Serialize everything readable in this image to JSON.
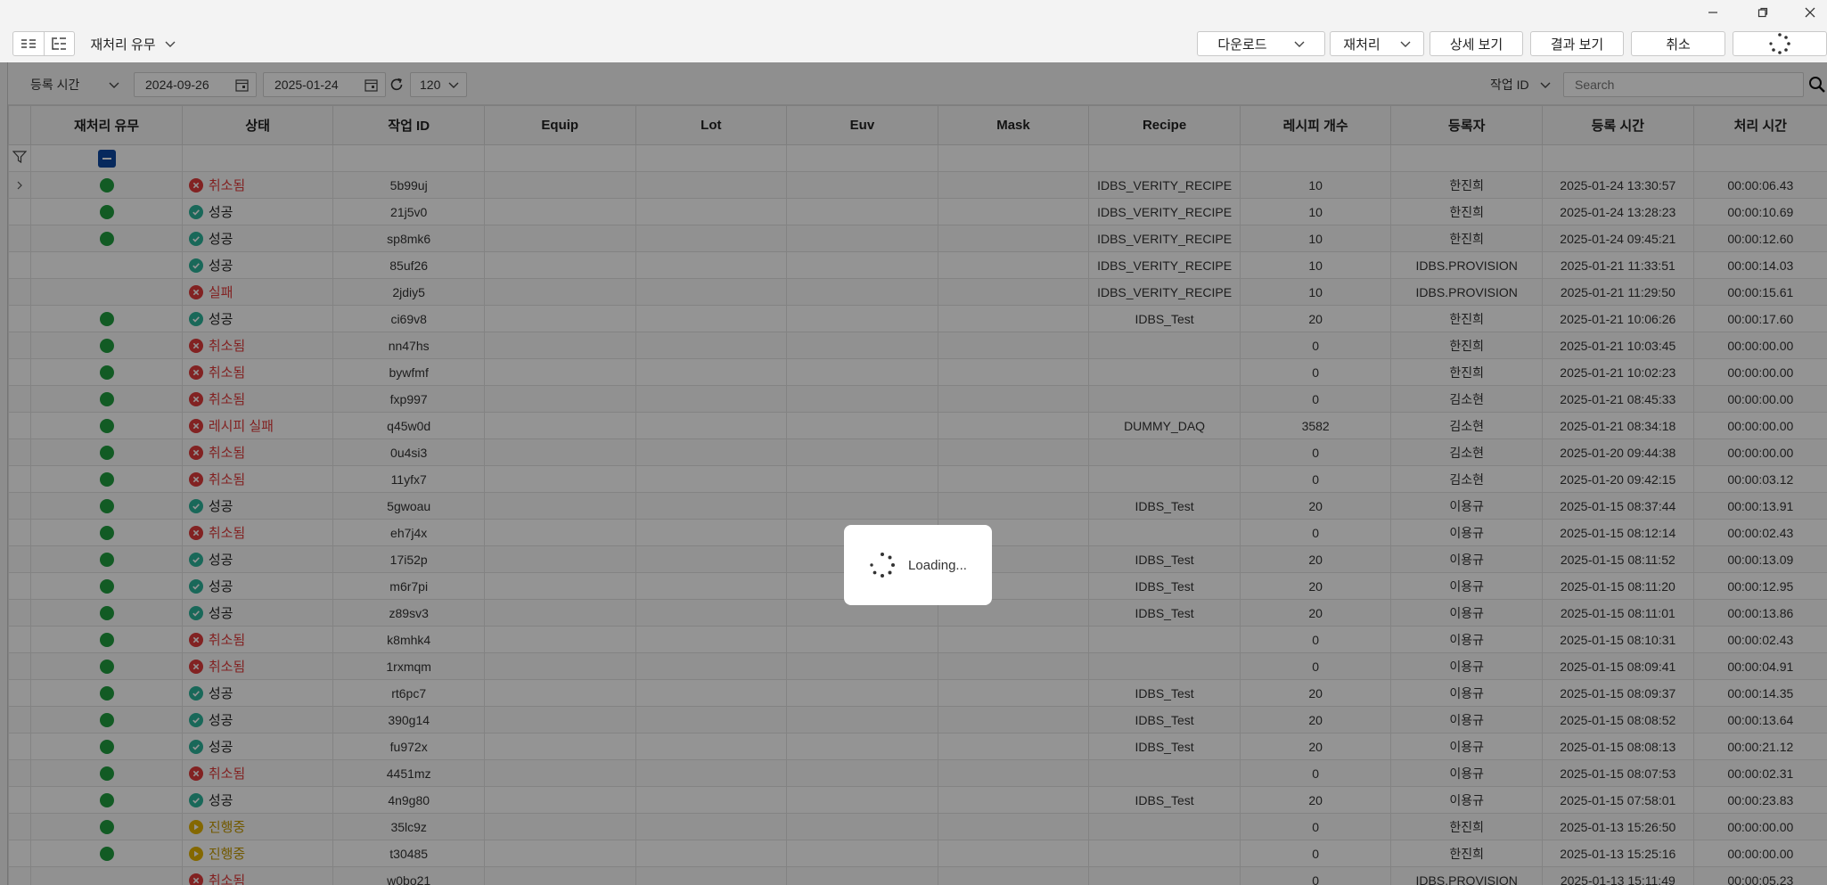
{
  "window": {
    "minimize_icon": "minimize-icon",
    "restore_icon": "restore-icon",
    "close_icon": "close-icon"
  },
  "toolbar": {
    "reprocess_filter_label": "재처리 유무",
    "download_label": "다운로드",
    "reprocess_label": "재처리",
    "detail_label": "상세 보기",
    "result_label": "결과 보기",
    "cancel_label": "취소"
  },
  "filters": {
    "date_field": "등록 시간",
    "start_date": "2024-09-26",
    "end_date": "2025-01-24",
    "page_size": "120",
    "search_field": "작업 ID",
    "search_placeholder": "Search"
  },
  "table": {
    "columns": [
      "재처리 유무",
      "상태",
      "작업 ID",
      "Equip",
      "Lot",
      "Euv",
      "Mask",
      "Recipe",
      "레시피 개수",
      "등록자",
      "등록 시간",
      "처리 시간"
    ],
    "rows": [
      {
        "reprocessed": true,
        "status": "취소됨",
        "kind": "x",
        "id": "5b99uj",
        "recipe": "IDBS_VERITY_RECIPE",
        "count": "10",
        "user": "한진희",
        "registered": "2025-01-24 13:30:57",
        "duration": "00:00:06.43"
      },
      {
        "reprocessed": true,
        "status": "성공",
        "kind": "ok",
        "id": "21j5v0",
        "recipe": "IDBS_VERITY_RECIPE",
        "count": "10",
        "user": "한진희",
        "registered": "2025-01-24 13:28:23",
        "duration": "00:00:10.69"
      },
      {
        "reprocessed": true,
        "status": "성공",
        "kind": "ok",
        "id": "sp8mk6",
        "recipe": "IDBS_VERITY_RECIPE",
        "count": "10",
        "user": "한진희",
        "registered": "2025-01-24 09:45:21",
        "duration": "00:00:12.60"
      },
      {
        "reprocessed": false,
        "status": "성공",
        "kind": "ok",
        "id": "85uf26",
        "recipe": "IDBS_VERITY_RECIPE",
        "count": "10",
        "user": "IDBS.PROVISION",
        "registered": "2025-01-21 11:33:51",
        "duration": "00:00:14.03"
      },
      {
        "reprocessed": false,
        "status": "실패",
        "kind": "x",
        "id": "2jdiy5",
        "recipe": "IDBS_VERITY_RECIPE",
        "count": "10",
        "user": "IDBS.PROVISION",
        "registered": "2025-01-21 11:29:50",
        "duration": "00:00:15.61"
      },
      {
        "reprocessed": true,
        "status": "성공",
        "kind": "ok",
        "id": "ci69v8",
        "recipe": "IDBS_Test",
        "count": "20",
        "user": "한진희",
        "registered": "2025-01-21 10:06:26",
        "duration": "00:00:17.60"
      },
      {
        "reprocessed": true,
        "status": "취소됨",
        "kind": "x",
        "id": "nn47hs",
        "recipe": "",
        "count": "0",
        "user": "한진희",
        "registered": "2025-01-21 10:03:45",
        "duration": "00:00:00.00"
      },
      {
        "reprocessed": true,
        "status": "취소됨",
        "kind": "x",
        "id": "bywfmf",
        "recipe": "",
        "count": "0",
        "user": "한진희",
        "registered": "2025-01-21 10:02:23",
        "duration": "00:00:00.00"
      },
      {
        "reprocessed": true,
        "status": "취소됨",
        "kind": "x",
        "id": "fxp997",
        "recipe": "",
        "count": "0",
        "user": "김소현",
        "registered": "2025-01-21 08:45:33",
        "duration": "00:00:00.00"
      },
      {
        "reprocessed": true,
        "status": "레시피 실패",
        "kind": "x",
        "id": "q45w0d",
        "recipe": "DUMMY_DAQ",
        "count": "3582",
        "user": "김소현",
        "registered": "2025-01-21 08:34:18",
        "duration": "00:00:00.00"
      },
      {
        "reprocessed": true,
        "status": "취소됨",
        "kind": "x",
        "id": "0u4si3",
        "recipe": "",
        "count": "0",
        "user": "김소현",
        "registered": "2025-01-20 09:44:38",
        "duration": "00:00:00.00"
      },
      {
        "reprocessed": true,
        "status": "취소됨",
        "kind": "x",
        "id": "11yfx7",
        "recipe": "",
        "count": "0",
        "user": "김소현",
        "registered": "2025-01-20 09:42:15",
        "duration": "00:00:03.12"
      },
      {
        "reprocessed": true,
        "status": "성공",
        "kind": "ok",
        "id": "5gwoau",
        "recipe": "IDBS_Test",
        "count": "20",
        "user": "이용규",
        "registered": "2025-01-15 08:37:44",
        "duration": "00:00:13.91"
      },
      {
        "reprocessed": true,
        "status": "취소됨",
        "kind": "x",
        "id": "eh7j4x",
        "recipe": "",
        "count": "0",
        "user": "이용규",
        "registered": "2025-01-15 08:12:14",
        "duration": "00:00:02.43"
      },
      {
        "reprocessed": true,
        "status": "성공",
        "kind": "ok",
        "id": "17i52p",
        "recipe": "IDBS_Test",
        "count": "20",
        "user": "이용규",
        "registered": "2025-01-15 08:11:52",
        "duration": "00:00:13.09"
      },
      {
        "reprocessed": true,
        "status": "성공",
        "kind": "ok",
        "id": "m6r7pi",
        "recipe": "IDBS_Test",
        "count": "20",
        "user": "이용규",
        "registered": "2025-01-15 08:11:20",
        "duration": "00:00:12.95"
      },
      {
        "reprocessed": true,
        "status": "성공",
        "kind": "ok",
        "id": "z89sv3",
        "recipe": "IDBS_Test",
        "count": "20",
        "user": "이용규",
        "registered": "2025-01-15 08:11:01",
        "duration": "00:00:13.86"
      },
      {
        "reprocessed": true,
        "status": "취소됨",
        "kind": "x",
        "id": "k8mhk4",
        "recipe": "",
        "count": "0",
        "user": "이용규",
        "registered": "2025-01-15 08:10:31",
        "duration": "00:00:02.43"
      },
      {
        "reprocessed": true,
        "status": "취소됨",
        "kind": "x",
        "id": "1rxmqm",
        "recipe": "",
        "count": "0",
        "user": "이용규",
        "registered": "2025-01-15 08:09:41",
        "duration": "00:00:04.91"
      },
      {
        "reprocessed": true,
        "status": "성공",
        "kind": "ok",
        "id": "rt6pc7",
        "recipe": "IDBS_Test",
        "count": "20",
        "user": "이용규",
        "registered": "2025-01-15 08:09:37",
        "duration": "00:00:14.35"
      },
      {
        "reprocessed": true,
        "status": "성공",
        "kind": "ok",
        "id": "390g14",
        "recipe": "IDBS_Test",
        "count": "20",
        "user": "이용규",
        "registered": "2025-01-15 08:08:52",
        "duration": "00:00:13.64"
      },
      {
        "reprocessed": true,
        "status": "성공",
        "kind": "ok",
        "id": "fu972x",
        "recipe": "IDBS_Test",
        "count": "20",
        "user": "이용규",
        "registered": "2025-01-15 08:08:13",
        "duration": "00:00:21.12"
      },
      {
        "reprocessed": true,
        "status": "취소됨",
        "kind": "x",
        "id": "4451mz",
        "recipe": "",
        "count": "0",
        "user": "이용규",
        "registered": "2025-01-15 08:07:53",
        "duration": "00:00:02.31"
      },
      {
        "reprocessed": true,
        "status": "성공",
        "kind": "ok",
        "id": "4n9g80",
        "recipe": "IDBS_Test",
        "count": "20",
        "user": "이용규",
        "registered": "2025-01-15 07:58:01",
        "duration": "00:00:23.83"
      },
      {
        "reprocessed": true,
        "status": "진행중",
        "kind": "run",
        "id": "35lc9z",
        "recipe": "",
        "count": "0",
        "user": "한진희",
        "registered": "2025-01-13 15:26:50",
        "duration": "00:00:00.00"
      },
      {
        "reprocessed": true,
        "status": "진행중",
        "kind": "run",
        "id": "t30485",
        "recipe": "",
        "count": "0",
        "user": "한진희",
        "registered": "2025-01-13 15:25:16",
        "duration": "00:00:00.00"
      },
      {
        "reprocessed": false,
        "status": "취소됨",
        "kind": "x",
        "id": "w0bo21",
        "recipe": "",
        "count": "0",
        "user": "IDBS.PROVISION",
        "registered": "2025-01-13 15:11:49",
        "duration": "00:00:05.23"
      }
    ]
  },
  "loading": {
    "text": "Loading..."
  },
  "colors": {
    "success": "#2bb39a",
    "failure": "#e03b3b",
    "running": "#e4b400",
    "reprocessed_dot": "#1f9d3f",
    "filter_accent": "#0d47a1"
  }
}
